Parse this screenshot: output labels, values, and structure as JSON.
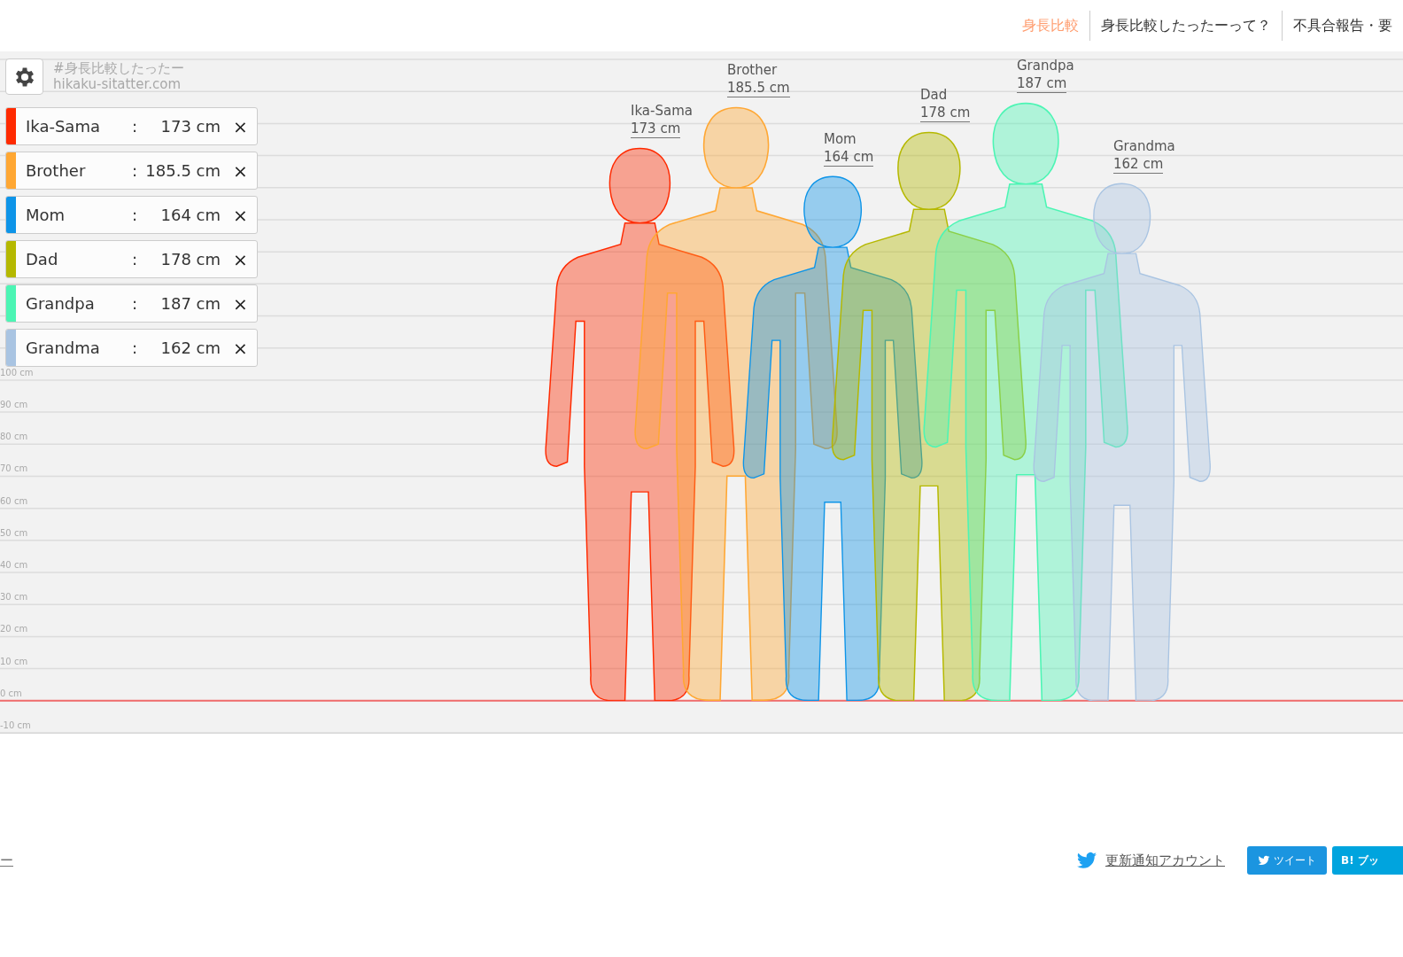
{
  "nav": [
    {
      "label": "身長比較",
      "selected": true
    },
    {
      "label": "身長比較したったーって？",
      "selected": false
    },
    {
      "label": "不具合報告・要",
      "selected": false
    }
  ],
  "canvas_caption": [
    "#身長比較したったー",
    "hikaku-sitatter.com"
  ],
  "people": [
    {
      "name": "Ika-Sama",
      "separator": ":",
      "height": "173 cm",
      "color": "#ff2a00",
      "figure_name": "Ika-Sama",
      "figure_height": "173 cm"
    },
    {
      "name": "Brother",
      "separator": ":",
      "height": "185.5 cm",
      "color": "#ffa733",
      "figure_name": "Brother",
      "figure_height": "185.5 cm"
    },
    {
      "name": "Mom",
      "separator": ":",
      "height": "164 cm",
      "color": "#0d94e8",
      "figure_name": "Mom",
      "figure_height": "164 cm"
    },
    {
      "name": "Dad",
      "separator": ":",
      "height": "178 cm",
      "color": "#b5b800",
      "figure_name": "Dad",
      "figure_height": "178 cm"
    },
    {
      "name": "Grandpa",
      "separator": ":",
      "height": "187 cm",
      "color": "#4cf5b4",
      "figure_name": "Grandpa",
      "figure_height": "187 cm"
    },
    {
      "name": "Grandma",
      "separator": ":",
      "height": "162 cm",
      "color": "#a9c4e2",
      "figure_name": "Grandma",
      "figure_height": "162 cm"
    }
  ],
  "scale_labels": [
    "100 cm",
    "90 cm",
    "80 cm",
    "70 cm",
    "60 cm",
    "50 cm",
    "40 cm",
    "30 cm",
    "20 cm",
    "10 cm",
    "0 cm",
    "-10 cm"
  ],
  "remove_glyph": "×",
  "footer": {
    "left_link": "ー",
    "account_link": "更新通知アカウント",
    "tweet_button": "ツイート",
    "bookmark_button": "B! ブッ"
  }
}
